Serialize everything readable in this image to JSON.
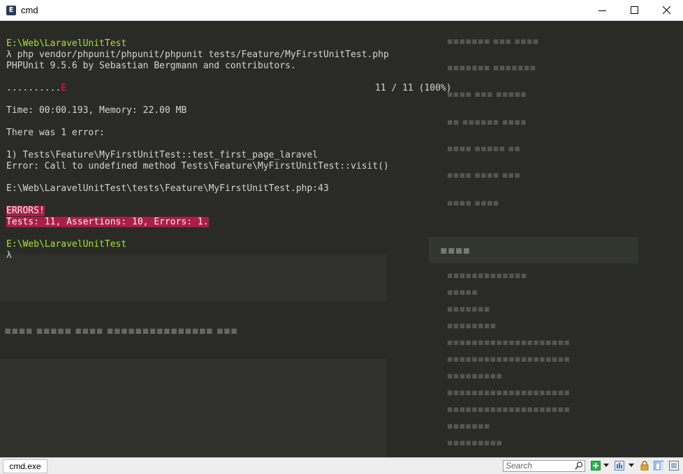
{
  "window": {
    "title": "cmd",
    "icon": "console-app-icon",
    "controls": [
      "minimize-icon",
      "maximize-icon",
      "close-icon"
    ]
  },
  "terminal": {
    "lines": [
      {
        "text": "E:\\Web\\LaravelUnitTest",
        "style": "green"
      },
      {
        "text": "λ php vendor/phpunit/phpunit/phpunit tests/Feature/MyFirstUnitTest.php",
        "style": "normal"
      },
      {
        "text": "PHPUnit 9.5.6 by Sebastian Bergmann and contributors.",
        "style": "normal"
      },
      {
        "text": "",
        "style": "normal"
      },
      {
        "text": "",
        "style": "normal"
      },
      {
        "text": "Time: 00:00.193, Memory: 22.00 MB",
        "style": "normal"
      },
      {
        "text": "",
        "style": "normal"
      },
      {
        "text": "There was 1 error:",
        "style": "normal"
      },
      {
        "text": "",
        "style": "normal"
      },
      {
        "text": "1) Tests\\Feature\\MyFirstUnitTest::test_first_page_laravel",
        "style": "normal"
      },
      {
        "text": "Error: Call to undefined method Tests\\Feature\\MyFirstUnitTest::visit()",
        "style": "normal"
      },
      {
        "text": "",
        "style": "normal"
      },
      {
        "text": "E:\\Web\\LaravelUnitTest\\tests\\Feature\\MyFirstUnitTest.php:43",
        "style": "normal"
      },
      {
        "text": "",
        "style": "normal"
      },
      {
        "text": "ERRORS!",
        "style": "error"
      },
      {
        "text": "Tests: 11, Assertions: 10, Errors: 1.",
        "style": "error"
      },
      {
        "text": "",
        "style": "normal"
      },
      {
        "text": "E:\\Web\\LaravelUnitTest",
        "style": "green"
      },
      {
        "text": "λ",
        "style": "normal"
      }
    ],
    "progress": {
      "dots": "..........",
      "error_mark": "E",
      "count": "11 / 11 (100%)"
    }
  },
  "statusbar": {
    "tab_label": "cmd.exe",
    "search_placeholder": "Search",
    "icons": [
      "search-icon",
      "add-console-icon",
      "dropdown-icon",
      "view-icon",
      "dropdown-icon",
      "lock-icon",
      "split-view-icon",
      "settings-icon"
    ]
  }
}
